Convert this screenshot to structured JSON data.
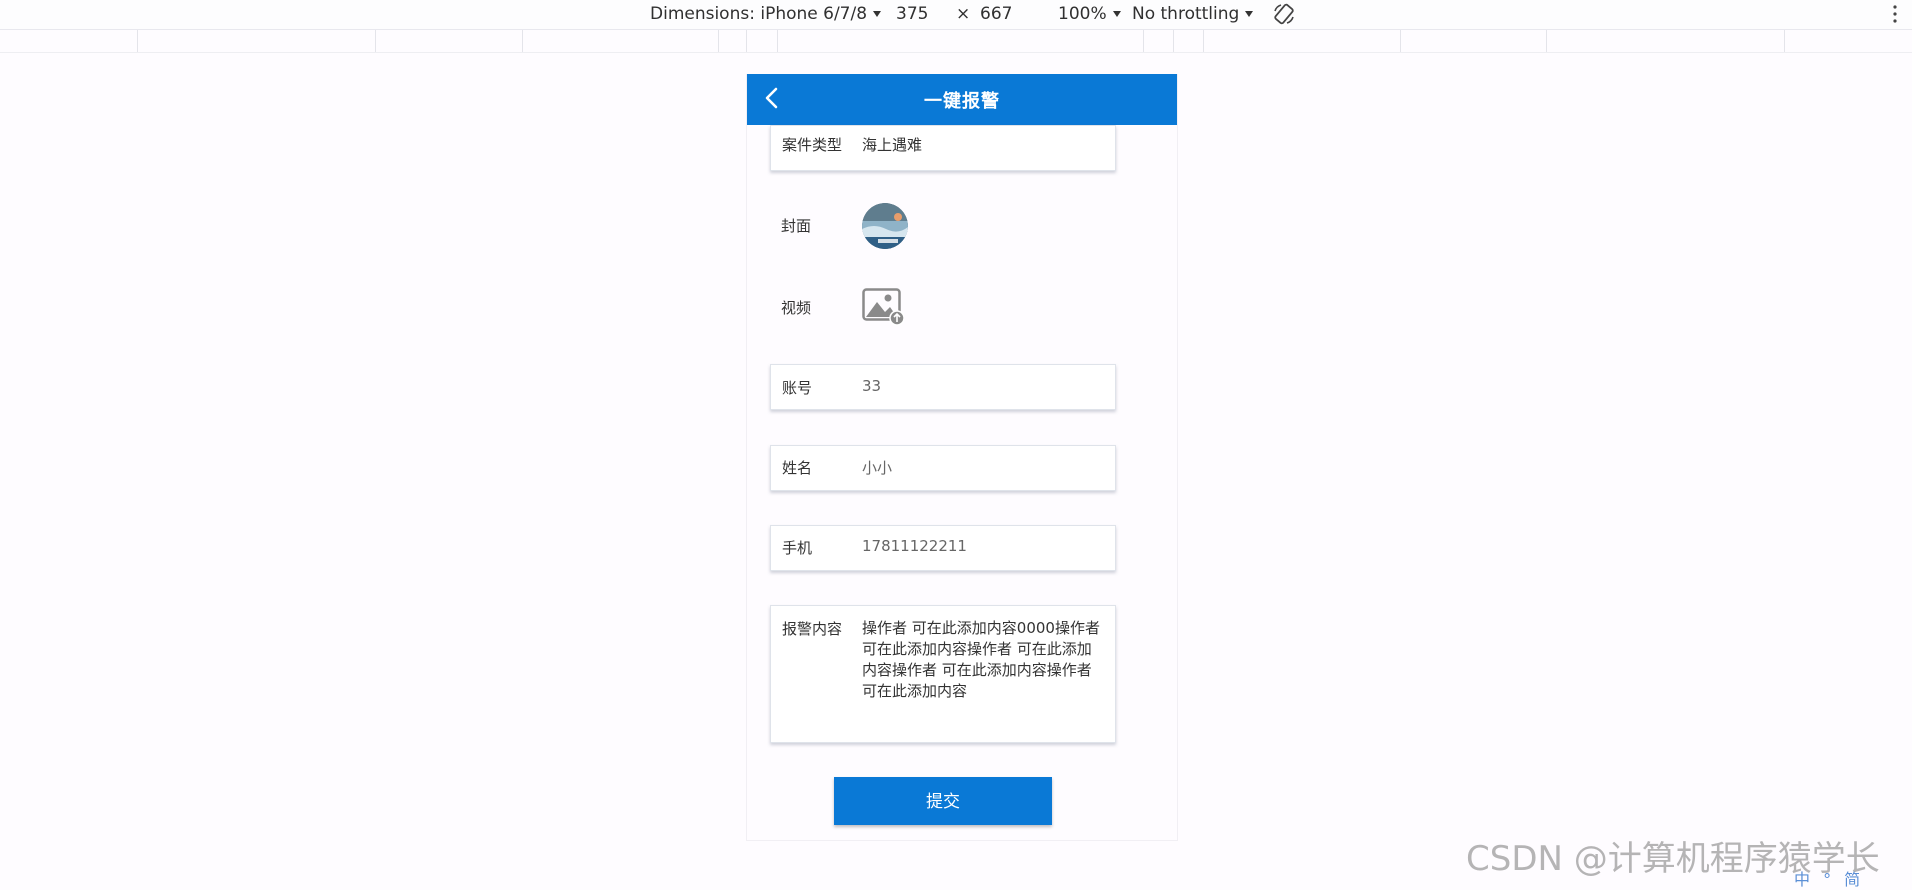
{
  "devtools": {
    "dimensions_label": "Dimensions: iPhone 6/7/8",
    "width": "375",
    "times": "×",
    "height": "667",
    "zoom": "100%",
    "throttling": "No throttling",
    "icons": [
      "rotate-icon",
      "more-options-icon"
    ]
  },
  "header": {
    "title": "一键报警",
    "back_icon": "chevron-left-icon",
    "color": "#0a79d6"
  },
  "form": {
    "case_type": {
      "label": "案件类型",
      "value": "海上遇难"
    },
    "cover": {
      "label": "封面"
    },
    "video": {
      "label": "视频",
      "icon": "image-upload-icon"
    },
    "account": {
      "label": "账号",
      "value": "33"
    },
    "name": {
      "label": "姓名",
      "value": "小小"
    },
    "phone": {
      "label": "手机",
      "value": "17811122211"
    },
    "content": {
      "label": "报警内容",
      "value": "操作者 可在此添加内容0000操作者 可在此添加内容操作者 可在此添加内容操作者 可在此添加内容操作者 可在此添加内容"
    },
    "submit_label": "提交"
  },
  "watermark": {
    "text": "CSDN @计算机程序猿学长",
    "ime": "中 ° 简"
  }
}
